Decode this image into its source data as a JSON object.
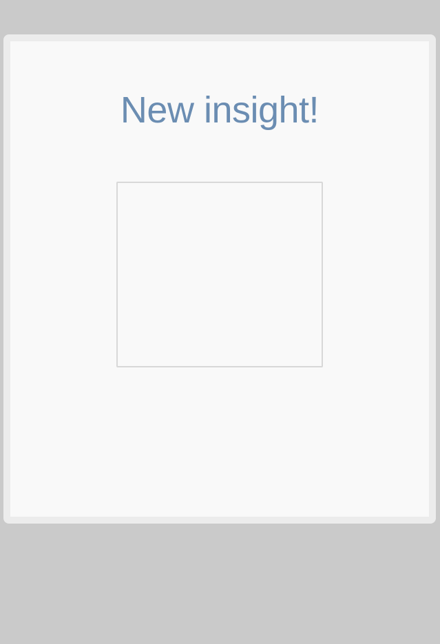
{
  "dialog": {
    "title": "New insight!",
    "colors": {
      "backdrop": "#cacaca",
      "dialog_border": "#ececec",
      "dialog_background": "#f9f9f9",
      "title_text": "#6b8db2",
      "frame_border": "#d8d8d8"
    }
  }
}
